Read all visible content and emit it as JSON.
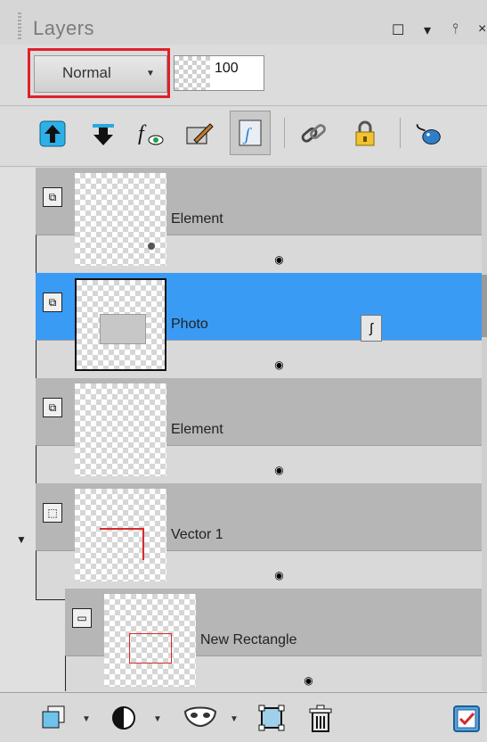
{
  "panel": {
    "title": "Layers",
    "window_controls": {
      "restore_icon": "☐",
      "menu_icon": "▾",
      "pin_icon": "⫯",
      "close_icon": "×"
    }
  },
  "blend": {
    "mode": "Normal",
    "opacity": "100"
  },
  "toolbar": {
    "icons": [
      "move-up-icon",
      "move-down-icon",
      "layer-effects-icon",
      "edit-image-icon",
      "vector-path-icon",
      "link-icon",
      "lock-icon",
      "mouse-select-icon"
    ]
  },
  "layers": [
    {
      "name": "Element",
      "type": "raster"
    },
    {
      "name": "Photo",
      "type": "raster",
      "selected": true
    },
    {
      "name": "Element",
      "type": "raster"
    },
    {
      "name": "Vector 1",
      "type": "vector-group"
    },
    {
      "name": "New Rectangle",
      "type": "vector-shape",
      "child": true
    }
  ],
  "colors": {
    "selected_row": "#3a9bf5",
    "row": "#b6b6b6",
    "highlight": "#e0202a",
    "vector_stroke": "#d72b2b"
  }
}
